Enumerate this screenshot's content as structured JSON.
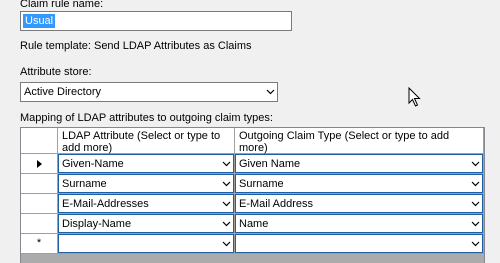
{
  "claim_rule_name": {
    "label": "Claim rule name:",
    "value": "Usual"
  },
  "rule_template": "Rule template: Send LDAP Attributes as Claims",
  "attribute_store": {
    "label": "Attribute store:",
    "value": "Active Directory"
  },
  "mapping": {
    "label": "Mapping of LDAP attributes to outgoing claim types:",
    "columns": [
      "LDAP Attribute (Select or type to add more)",
      "Outgoing Claim Type (Select or type to add more)"
    ],
    "rows": [
      {
        "marker": "current",
        "ldap": "Given-Name",
        "claim": "Given Name"
      },
      {
        "marker": "",
        "ldap": "Surname",
        "claim": "Surname"
      },
      {
        "marker": "",
        "ldap": "E-Mail-Addresses",
        "claim": "E-Mail Address"
      },
      {
        "marker": "",
        "ldap": "Display-Name",
        "claim": "Name"
      },
      {
        "marker": "new",
        "ldap": "",
        "claim": ""
      }
    ],
    "new_row_marker": "*"
  }
}
